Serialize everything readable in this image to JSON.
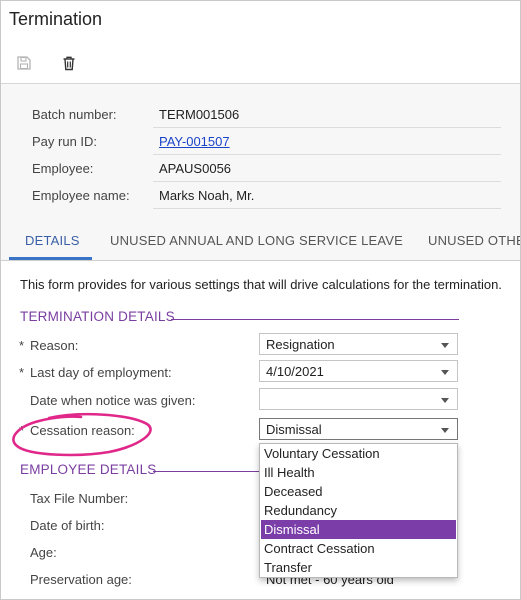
{
  "window": {
    "title": "Termination"
  },
  "toolbar": {
    "save_icon": "save-icon",
    "delete_icon": "trash-icon"
  },
  "summary": {
    "rows": [
      {
        "label": "Batch number:",
        "value": "TERM001506"
      },
      {
        "label": "Pay run ID:",
        "value": "PAY-001507"
      },
      {
        "label": "Employee:",
        "value": "APAUS0056"
      },
      {
        "label": "Employee name:",
        "value": "Marks Noah, Mr."
      }
    ]
  },
  "tabs": [
    {
      "label": "DETAILS",
      "active": true
    },
    {
      "label": "UNUSED ANNUAL AND LONG SERVICE LEAVE",
      "active": false
    },
    {
      "label": "UNUSED OTHE",
      "active": false
    }
  ],
  "description": "This form provides for various settings that will drive calculations for the termination.",
  "termination_details": {
    "heading": "TERMINATION DETAILS",
    "fields": [
      {
        "label": "Reason:",
        "required": "*",
        "value": "Resignation"
      },
      {
        "label": "Last day of employment:",
        "required": "*",
        "value": "4/10/2021"
      },
      {
        "label": "Date when notice was given:",
        "required": "",
        "value": ""
      },
      {
        "label": "Cessation reason:",
        "required": "*",
        "value": "Dismissal"
      }
    ]
  },
  "employee_details": {
    "heading": "EMPLOYEE DETAILS",
    "fields": [
      {
        "label": "Tax File Number:"
      },
      {
        "label": "Date of birth:"
      },
      {
        "label": "Age:"
      },
      {
        "label": "Preservation age:",
        "value": "Not met - 60 years old"
      }
    ]
  },
  "cessation_dropdown": {
    "options": [
      "Voluntary Cessation",
      "Ill Health",
      "Deceased",
      "Redundancy",
      "Dismissal",
      "Contract Cessation",
      "Transfer"
    ],
    "selected": "Dismissal"
  },
  "colors": {
    "accent_purple": "#7b3ea8",
    "tab_blue": "#3a74c7",
    "highlight_pink": "#e0278a",
    "link_blue": "#1a44c8"
  }
}
